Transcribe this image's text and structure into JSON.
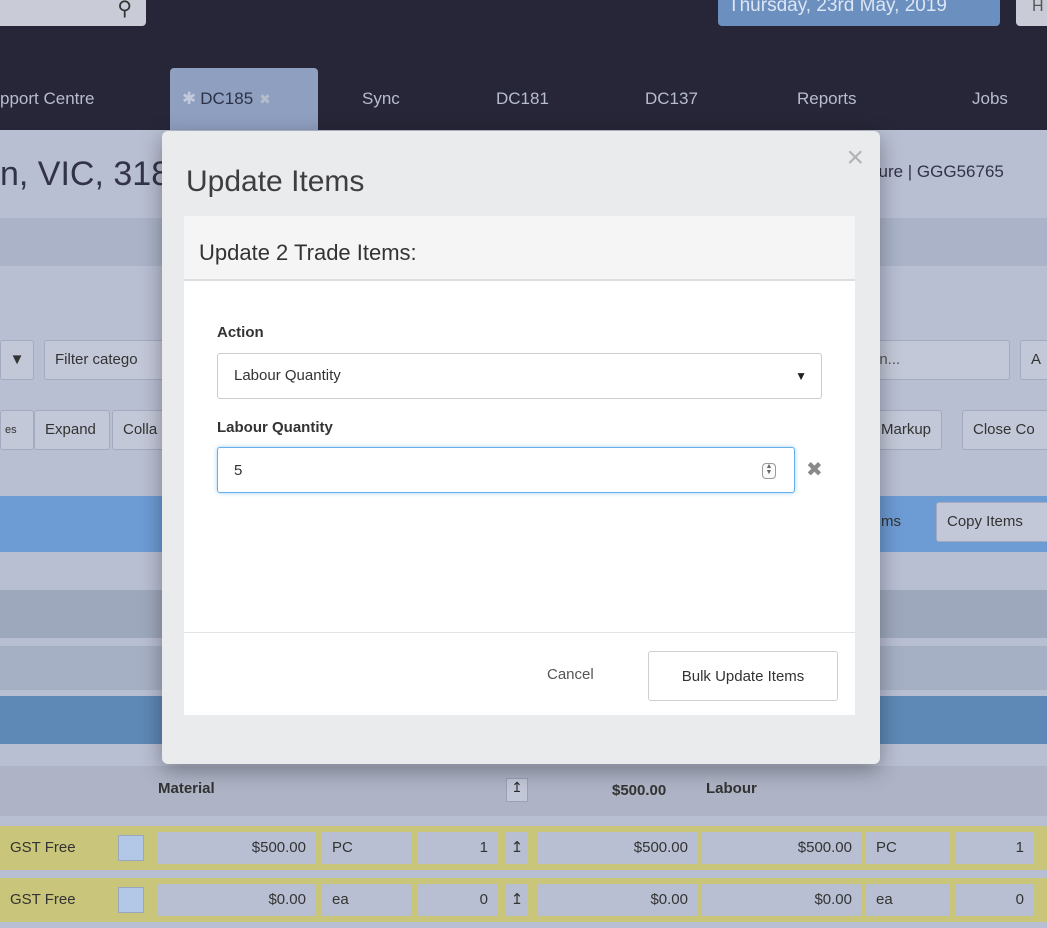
{
  "header": {
    "date": "Thursday, 23rd May, 2019",
    "search_icon": "search-icon"
  },
  "tabs": [
    {
      "label": "pport Centre"
    },
    {
      "label": "DC185",
      "active": true
    },
    {
      "label": "Sync"
    },
    {
      "label": "DC181"
    },
    {
      "label": "DC137"
    },
    {
      "label": "Reports"
    },
    {
      "label": "Jobs"
    }
  ],
  "job": {
    "address": "n, VIC, 318",
    "reference": "sure | GGG56765"
  },
  "toolbar": {
    "filter_category": "Filter catego",
    "expand": "Expand",
    "collapse": "Colla",
    "rates_suffix": "es",
    "location_placeholder": "on...",
    "add": "A",
    "markup": "Markup",
    "close": "Close Co",
    "items_suffix": "ms",
    "copy_items": "Copy Items"
  },
  "table": {
    "material_header": "Material",
    "material_total": "$500.00",
    "labour_header": "Labour",
    "rows": [
      {
        "tax": "GST Free",
        "material_rate": "$500.00",
        "material_unit": "PC",
        "material_qty": "1",
        "material_total": "$500.00",
        "labour_rate": "$500.00",
        "labour_unit": "PC",
        "labour_qty": "1"
      },
      {
        "tax": "GST Free",
        "material_rate": "$0.00",
        "material_unit": "ea",
        "material_qty": "0",
        "material_total": "$0.00",
        "labour_rate": "$0.00",
        "labour_unit": "ea",
        "labour_qty": "0"
      }
    ]
  },
  "modal": {
    "title": "Update Items",
    "close_glyph": "×",
    "subtitle": "Update 2 Trade Items:",
    "action_label": "Action",
    "action_value": "Labour Quantity",
    "quantity_label": "Labour Quantity",
    "quantity_value": "5",
    "clear_glyph": "✖",
    "cancel": "Cancel",
    "submit": "Bulk Update Items"
  }
}
